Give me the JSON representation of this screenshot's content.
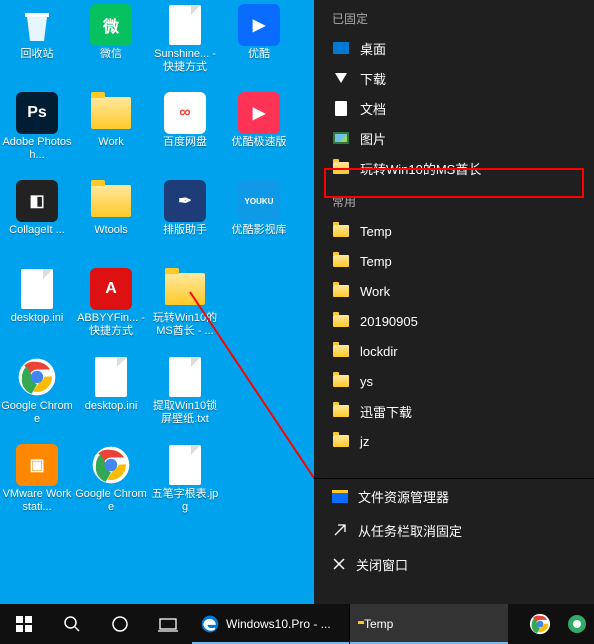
{
  "desktop": {
    "rows": [
      [
        {
          "name": "recycle-bin",
          "label": "回收站",
          "type": "recycle"
        },
        {
          "name": "wechat",
          "label": "微信",
          "type": "app",
          "bg": "#07c160",
          "glyph": "微"
        },
        {
          "name": "sunshine",
          "label": "Sunshine... - 快捷方式",
          "type": "file"
        },
        {
          "name": "youku",
          "label": "优酷",
          "type": "app",
          "bg": "#0a6cff",
          "glyph": "▶"
        }
      ],
      [
        {
          "name": "photoshop",
          "label": "Adobe Photosh...",
          "type": "app",
          "bg": "#001d34",
          "glyph": "Ps"
        },
        {
          "name": "work-folder",
          "label": "Work",
          "type": "folder"
        },
        {
          "name": "baidupan",
          "label": "百度网盘",
          "type": "app",
          "bg": "#ffffff",
          "glyph": "∞",
          "fg": "#e43"
        },
        {
          "name": "youku-fast",
          "label": "优酷极速版",
          "type": "app",
          "bg": "#ff3355",
          "glyph": "▶"
        }
      ],
      [
        {
          "name": "collageit",
          "label": "CollageIt ...",
          "type": "app",
          "bg": "#222",
          "glyph": "◧"
        },
        {
          "name": "wtools",
          "label": "Wtools",
          "type": "folder"
        },
        {
          "name": "paiban",
          "label": "排版助手",
          "type": "app",
          "bg": "#1e3c78",
          "glyph": "✒"
        },
        {
          "name": "youku-movie",
          "label": "优酷影视库",
          "type": "app",
          "bg": "#1099e6",
          "glyph": "YOUKU",
          "small": true
        }
      ],
      [
        {
          "name": "desktop-ini-1",
          "label": "desktop.ini",
          "type": "file"
        },
        {
          "name": "abbyy",
          "label": "ABBYYFin... - 快捷方式",
          "type": "app",
          "bg": "#d11",
          "glyph": "A"
        },
        {
          "name": "win10ms-folder",
          "label": "玩转Win10的MS酋长 - ...",
          "type": "folder"
        },
        {
          "name": "blank1",
          "label": "",
          "type": "none"
        }
      ],
      [
        {
          "name": "chrome-1",
          "label": "Google Chrome",
          "type": "chrome"
        },
        {
          "name": "desktop-ini-2",
          "label": "desktop.ini",
          "type": "file"
        },
        {
          "name": "win10lock",
          "label": "提取Win10锁屏壁纸.txt",
          "type": "text"
        },
        {
          "name": "blank2",
          "label": "",
          "type": "none"
        }
      ],
      [
        {
          "name": "vmware",
          "label": "VMware Workstati...",
          "type": "app",
          "bg": "#f80",
          "glyph": "▣"
        },
        {
          "name": "chrome-2",
          "label": "Google Chrome",
          "type": "chrome"
        },
        {
          "name": "wubi",
          "label": "五笔字根表.jpg",
          "type": "file"
        },
        {
          "name": "blank3",
          "label": "",
          "type": "none"
        }
      ]
    ]
  },
  "jumplist": {
    "pinned_title": "已固定",
    "pinned": [
      {
        "name": "jl-desktop",
        "icon": "desktop",
        "label": "桌面"
      },
      {
        "name": "jl-downloads",
        "icon": "download",
        "label": "下载"
      },
      {
        "name": "jl-documents",
        "icon": "doc",
        "label": "文档"
      },
      {
        "name": "jl-pictures",
        "icon": "pic",
        "label": "图片"
      },
      {
        "name": "jl-win10ms",
        "icon": "folder",
        "label": "玩转Win10的MS酋长"
      }
    ],
    "frequent_title": "常用",
    "frequent": [
      {
        "name": "jl-temp1",
        "icon": "folder",
        "label": "Temp"
      },
      {
        "name": "jl-temp2",
        "icon": "folder",
        "label": "Temp"
      },
      {
        "name": "jl-work",
        "icon": "folder",
        "label": "Work"
      },
      {
        "name": "jl-date",
        "icon": "folder",
        "label": "20190905"
      },
      {
        "name": "jl-lockdir",
        "icon": "folder",
        "label": "lockdir"
      },
      {
        "name": "jl-ys",
        "icon": "folder",
        "label": "ys"
      },
      {
        "name": "jl-xunlei",
        "icon": "folder",
        "label": "迅雷下载"
      },
      {
        "name": "jl-jz",
        "icon": "folder",
        "label": "jz"
      }
    ],
    "system": [
      {
        "name": "jl-explorer",
        "icon": "explorer",
        "label": "文件资源管理器"
      },
      {
        "name": "jl-unpin",
        "icon": "unpin",
        "label": "从任务栏取消固定"
      },
      {
        "name": "jl-close",
        "icon": "close",
        "label": "关闭窗口"
      }
    ]
  },
  "taskbar": {
    "start": "开始",
    "search": "搜索",
    "taskview": "任务视图",
    "edge_app": "Windows10.Pro - ...",
    "temp_app": "Temp"
  },
  "colors": {
    "highlight": "#ff0000"
  }
}
